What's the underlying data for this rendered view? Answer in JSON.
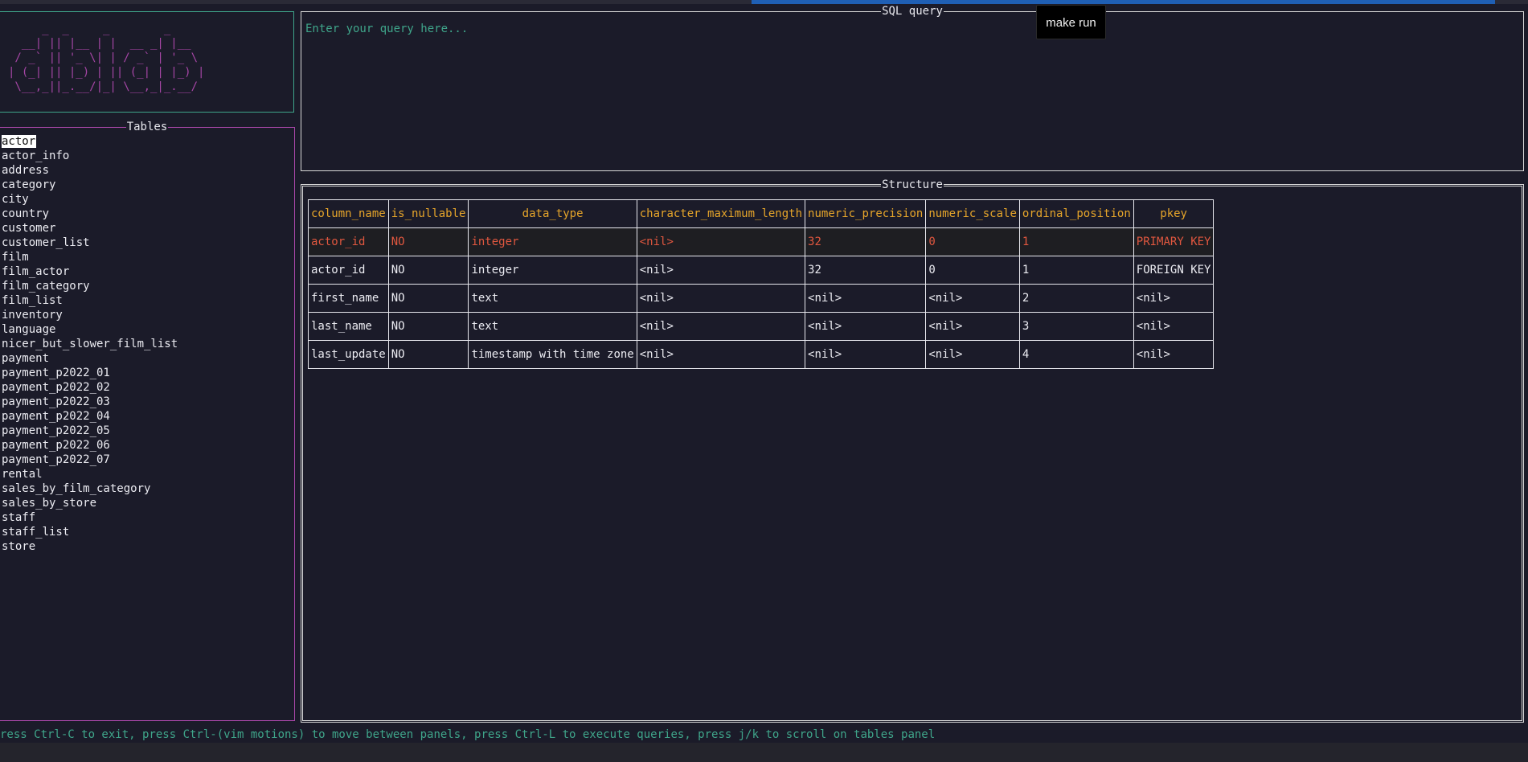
{
  "logo": {
    "ascii": "     _  _     _        _\n  __| || |__ | |  __ _| |__\n / _` || '_ \\| | / _` | '_ \\\n| (_| || |_) | || (_| | |_) |\n \\__,_||_.__/|_| \\__,_|_.__/"
  },
  "tables_panel": {
    "title": "Tables",
    "selected": "actor",
    "items": [
      "actor_info",
      "address",
      "category",
      "city",
      "country",
      "customer",
      "customer_list",
      "film",
      "film_actor",
      "film_category",
      "film_list",
      "inventory",
      "language",
      "nicer_but_slower_film_list",
      "payment",
      "payment_p2022_01",
      "payment_p2022_02",
      "payment_p2022_03",
      "payment_p2022_04",
      "payment_p2022_05",
      "payment_p2022_06",
      "payment_p2022_07",
      "rental",
      "sales_by_film_category",
      "sales_by_store",
      "staff",
      "staff_list",
      "store"
    ]
  },
  "sql_panel": {
    "title": "SQL query",
    "placeholder": "Enter your query here...",
    "value": ""
  },
  "tooltip": {
    "text": "make run"
  },
  "structure_panel": {
    "title": "Structure",
    "columns": [
      "column_name",
      "is_nullable",
      "data_type",
      "character_maximum_length",
      "numeric_precision",
      "numeric_scale",
      "ordinal_position",
      "pkey"
    ],
    "rows": [
      [
        "actor_id",
        "NO",
        "integer",
        "<nil>",
        "32",
        "0",
        "1",
        "PRIMARY KEY"
      ],
      [
        "actor_id",
        "NO",
        "integer",
        "<nil>",
        "32",
        "0",
        "1",
        "FOREIGN KEY"
      ],
      [
        "first_name",
        "NO",
        "text",
        "<nil>",
        "<nil>",
        "<nil>",
        "2",
        "<nil>"
      ],
      [
        "last_name",
        "NO",
        "text",
        "<nil>",
        "<nil>",
        "<nil>",
        "3",
        "<nil>"
      ],
      [
        "last_update",
        "NO",
        "timestamp with time zone",
        "<nil>",
        "<nil>",
        "<nil>",
        "4",
        "<nil>"
      ]
    ]
  },
  "status_bar": {
    "text": "ress Ctrl-C to exit, press Ctrl-(vim motions) to move between panels, press Ctrl-L to execute queries, press j/k to scroll on tables panel"
  },
  "colors": {
    "background": "#1b1b29",
    "logo_border": "#3fa58a",
    "logo_text": "#a646a6",
    "tables_border": "#a646a6",
    "header_text": "#e6a52a",
    "highlight_row": "#e0573f",
    "status_text": "#3fa58a",
    "accent_bar": "#1f5fb4"
  }
}
